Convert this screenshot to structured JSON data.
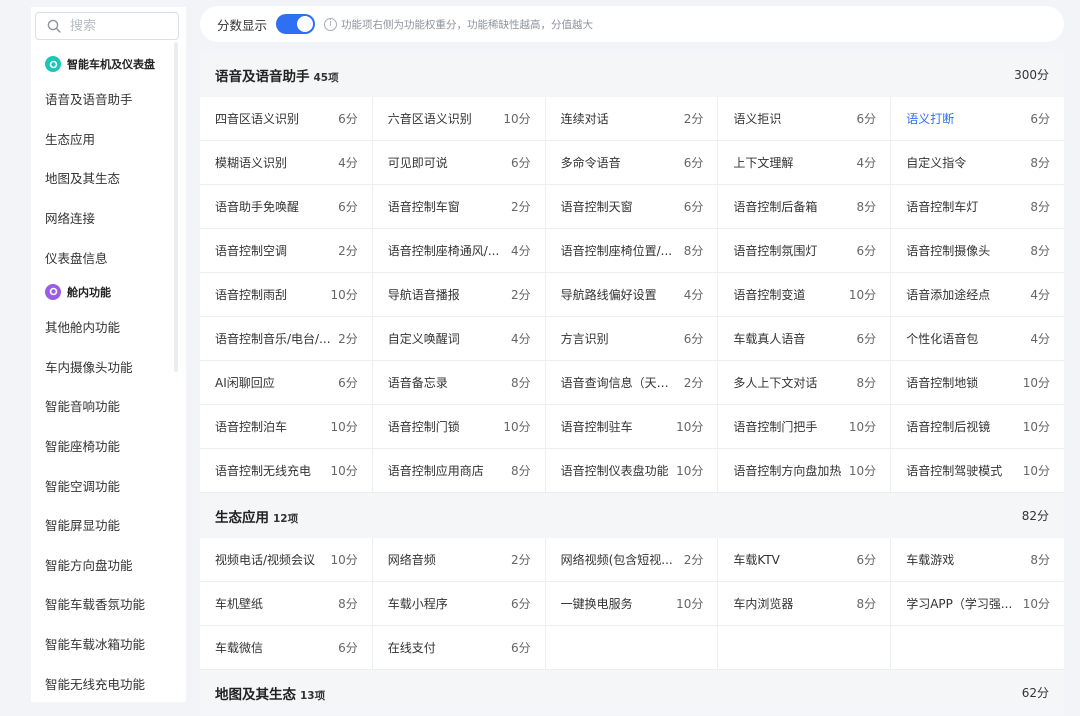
{
  "search": {
    "placeholder": "搜索"
  },
  "nav": [
    {
      "type": "group",
      "label": "智能车机及仪表盘",
      "icon": "car-screen-icon",
      "color": "#19c7b6"
    },
    {
      "type": "item",
      "label": "语音及语音助手"
    },
    {
      "type": "item",
      "label": "生态应用"
    },
    {
      "type": "item",
      "label": "地图及其生态"
    },
    {
      "type": "item",
      "label": "网络连接"
    },
    {
      "type": "item",
      "label": "仪表盘信息"
    },
    {
      "type": "group",
      "label": "舱内功能",
      "icon": "cabin-icon",
      "color": "#9b5de5"
    },
    {
      "type": "item",
      "label": "其他舱内功能"
    },
    {
      "type": "item",
      "label": "车内摄像头功能"
    },
    {
      "type": "item",
      "label": "智能音响功能"
    },
    {
      "type": "item",
      "label": "智能座椅功能"
    },
    {
      "type": "item",
      "label": "智能空调功能"
    },
    {
      "type": "item",
      "label": "智能屏显功能"
    },
    {
      "type": "item",
      "label": "智能方向盘功能"
    },
    {
      "type": "item",
      "label": "智能车载香氛功能"
    },
    {
      "type": "item",
      "label": "智能车载冰箱功能"
    },
    {
      "type": "item",
      "label": "智能无线充电功能"
    }
  ],
  "topbar": {
    "score_label": "分数显示",
    "toggle_on": true,
    "hint": "功能项右侧为功能权重分，功能稀缺性越高，分值越大",
    "accent": "#2f6ff1"
  },
  "sections": [
    {
      "title": "语音及语音助手",
      "count": "45项",
      "score": "300分",
      "items": [
        {
          "name": "四音区语义识别",
          "score": "6分"
        },
        {
          "name": "六音区语义识别",
          "score": "10分"
        },
        {
          "name": "连续对话",
          "score": "2分"
        },
        {
          "name": "语义拒识",
          "score": "6分"
        },
        {
          "name": "语义打断",
          "score": "6分",
          "highlight": true
        },
        {
          "name": "模糊语义识别",
          "score": "4分"
        },
        {
          "name": "可见即可说",
          "score": "6分"
        },
        {
          "name": "多命令语音",
          "score": "6分"
        },
        {
          "name": "上下文理解",
          "score": "4分"
        },
        {
          "name": "自定义指令",
          "score": "8分"
        },
        {
          "name": "语音助手免唤醒",
          "score": "6分"
        },
        {
          "name": "语音控制车窗",
          "score": "2分"
        },
        {
          "name": "语音控制天窗",
          "score": "6分"
        },
        {
          "name": "语音控制后备箱",
          "score": "8分"
        },
        {
          "name": "语音控制车灯",
          "score": "8分"
        },
        {
          "name": "语音控制空调",
          "score": "2分"
        },
        {
          "name": "语音控制座椅通风/...",
          "score": "4分"
        },
        {
          "name": "语音控制座椅位置/...",
          "score": "8分"
        },
        {
          "name": "语音控制氛围灯",
          "score": "6分"
        },
        {
          "name": "语音控制摄像头",
          "score": "8分"
        },
        {
          "name": "语音控制雨刮",
          "score": "10分"
        },
        {
          "name": "导航语音播报",
          "score": "2分"
        },
        {
          "name": "导航路线偏好设置",
          "score": "4分"
        },
        {
          "name": "语音控制变道",
          "score": "10分"
        },
        {
          "name": "语音添加途经点",
          "score": "4分"
        },
        {
          "name": "语音控制音乐/电台/...",
          "score": "2分"
        },
        {
          "name": "自定义唤醒词",
          "score": "4分"
        },
        {
          "name": "方言识别",
          "score": "6分"
        },
        {
          "name": "车载真人语音",
          "score": "6分"
        },
        {
          "name": "个性化语音包",
          "score": "4分"
        },
        {
          "name": "AI闲聊回应",
          "score": "6分"
        },
        {
          "name": "语音备忘录",
          "score": "8分"
        },
        {
          "name": "语音查询信息（天气...",
          "score": "2分"
        },
        {
          "name": "多人上下文对话",
          "score": "8分"
        },
        {
          "name": "语音控制地锁",
          "score": "10分"
        },
        {
          "name": "语音控制泊车",
          "score": "10分"
        },
        {
          "name": "语音控制门锁",
          "score": "10分"
        },
        {
          "name": "语音控制驻车",
          "score": "10分"
        },
        {
          "name": "语音控制门把手",
          "score": "10分"
        },
        {
          "name": "语音控制后视镜",
          "score": "10分"
        },
        {
          "name": "语音控制无线充电",
          "score": "10分"
        },
        {
          "name": "语音控制应用商店",
          "score": "8分"
        },
        {
          "name": "语音控制仪表盘功能",
          "score": "10分"
        },
        {
          "name": "语音控制方向盘加热",
          "score": "10分"
        },
        {
          "name": "语音控制驾驶模式",
          "score": "10分"
        }
      ]
    },
    {
      "title": "生态应用",
      "count": "12项",
      "score": "82分",
      "items": [
        {
          "name": "视频电话/视频会议",
          "score": "10分"
        },
        {
          "name": "网络音频",
          "score": "2分"
        },
        {
          "name": "网络视频(包含短视...",
          "score": "2分"
        },
        {
          "name": "车载KTV",
          "score": "6分"
        },
        {
          "name": "车载游戏",
          "score": "8分"
        },
        {
          "name": "车机壁纸",
          "score": "8分"
        },
        {
          "name": "车载小程序",
          "score": "6分"
        },
        {
          "name": "一键换电服务",
          "score": "10分"
        },
        {
          "name": "车内浏览器",
          "score": "8分"
        },
        {
          "name": "学习APP（学习强...",
          "score": "10分"
        },
        {
          "name": "车载微信",
          "score": "6分"
        },
        {
          "name": "在线支付",
          "score": "6分"
        },
        {
          "name": "",
          "score": ""
        },
        {
          "name": "",
          "score": ""
        },
        {
          "name": "",
          "score": ""
        }
      ]
    },
    {
      "title": "地图及其生态",
      "count": "13项",
      "score": "62分",
      "items": []
    }
  ]
}
